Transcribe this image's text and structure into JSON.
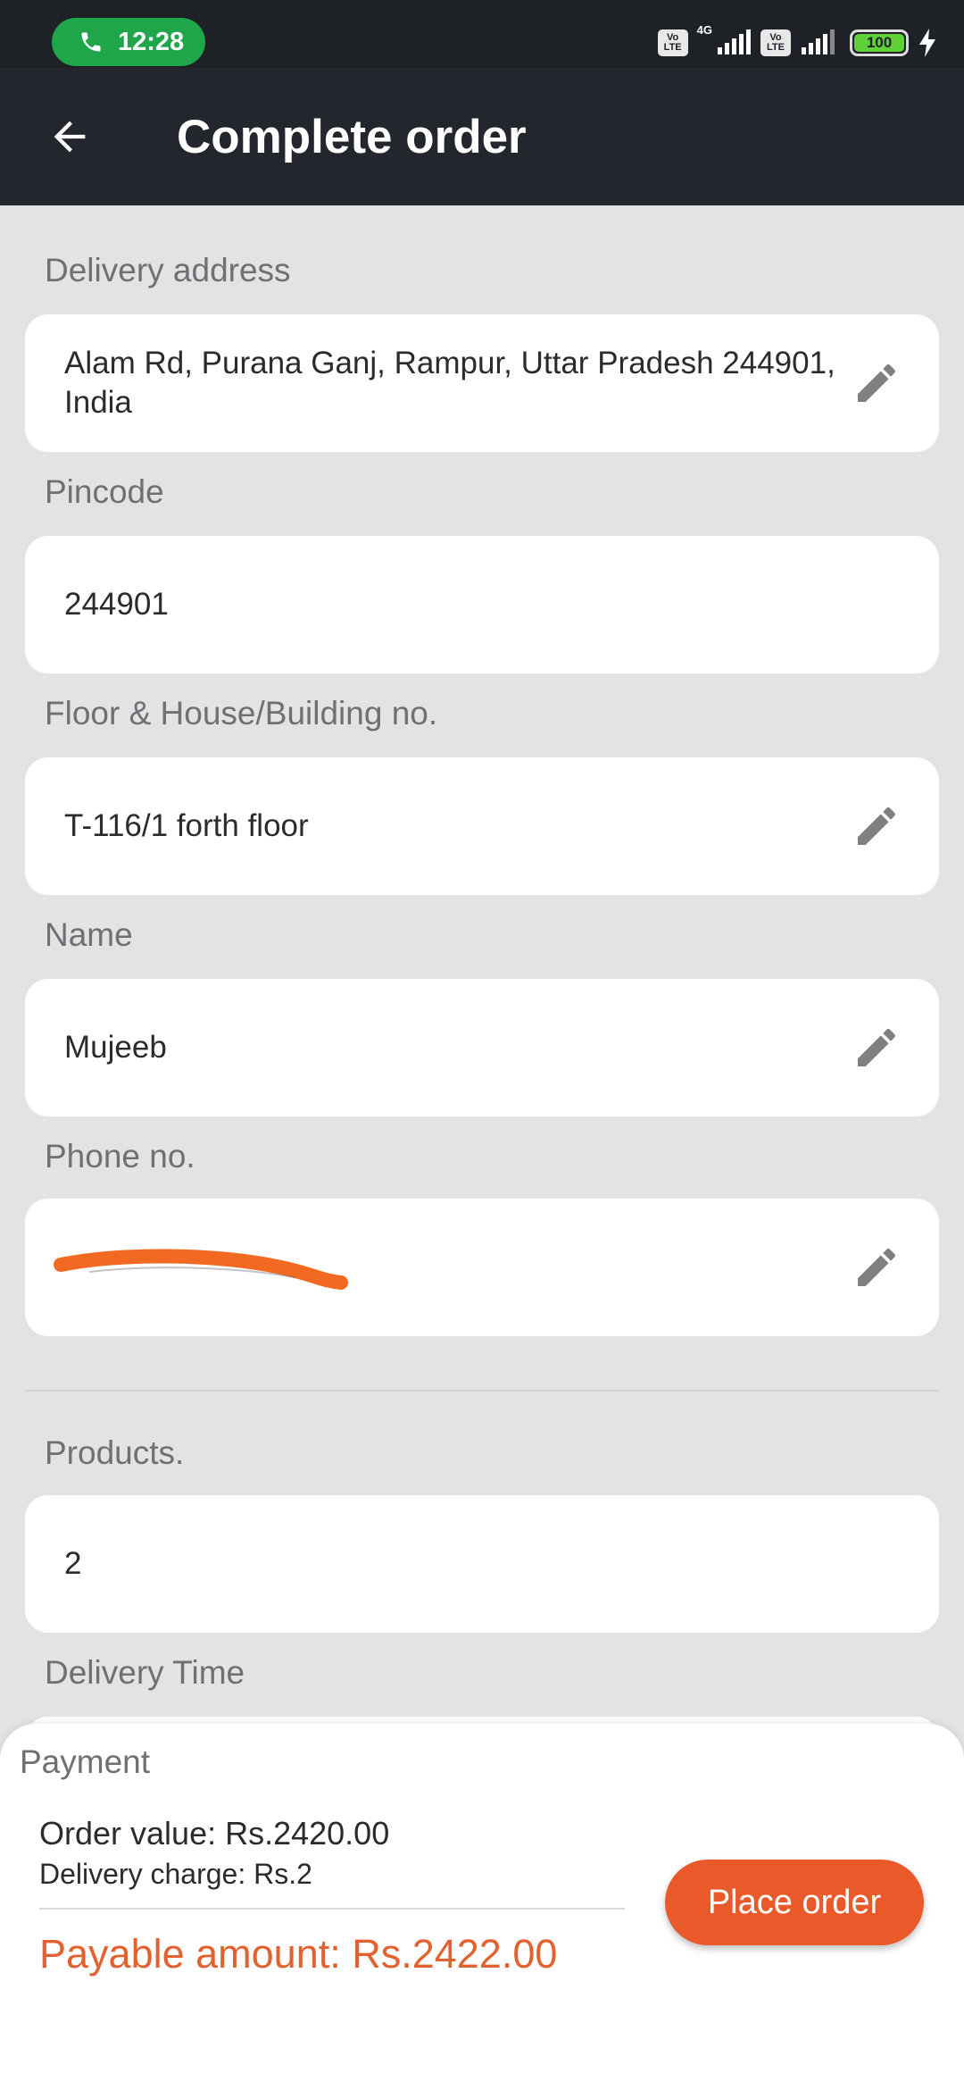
{
  "status_bar": {
    "time": "12:28",
    "network_label": "4G",
    "volte_label_top": "Vo",
    "volte_label_bottom": "LTE",
    "battery_level": "100"
  },
  "header": {
    "title": "Complete order"
  },
  "form": {
    "delivery_address": {
      "label": "Delivery address",
      "value": "Alam Rd, Purana Ganj, Rampur, Uttar Pradesh 244901, India"
    },
    "pincode": {
      "label": "Pincode",
      "value": "244901"
    },
    "floor": {
      "label": "Floor & House/Building no.",
      "value": "T-116/1 forth floor"
    },
    "name": {
      "label": "Name",
      "value": "Mujeeb"
    },
    "phone": {
      "label": "Phone no.",
      "value": ""
    },
    "products": {
      "label": "Products.",
      "value": "2"
    },
    "delivery_time": {
      "label": "Delivery Time"
    }
  },
  "payment": {
    "title": "Payment",
    "order_value": "Order value: Rs.2420.00",
    "delivery_charge": "Delivery charge: Rs.2",
    "payable": "Payable amount: Rs.2422.00",
    "place_order_label": "Place order"
  },
  "colors": {
    "accent": "#e9592a",
    "payable_text": "#e2612f",
    "app_bar": "#23272d",
    "background": "#e2e3e5"
  }
}
